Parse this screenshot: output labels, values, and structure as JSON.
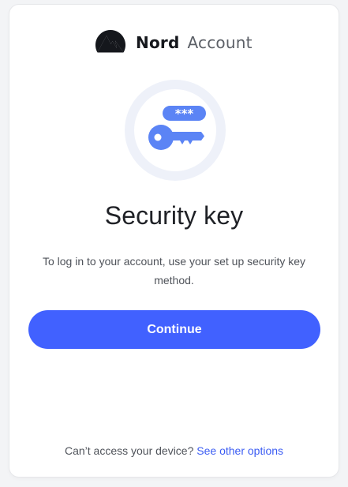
{
  "brand": {
    "name": "Nord",
    "product": "Account",
    "icon": "nord-mountain-logo-icon"
  },
  "illustration": {
    "icon": "security-key-icon",
    "key_badge_text": "***"
  },
  "title": "Security key",
  "description": "To log in to your account, use your set up security key method.",
  "continue_button": {
    "label": "Continue"
  },
  "footer": {
    "question": "Can’t access your device?",
    "link_label": "See other options"
  },
  "colors": {
    "accent": "#4161ff",
    "link": "#3b5cf3",
    "key_blue": "#5b84f5",
    "ring_outer": "#eef1f9",
    "ring_inner": "#ffffff"
  }
}
